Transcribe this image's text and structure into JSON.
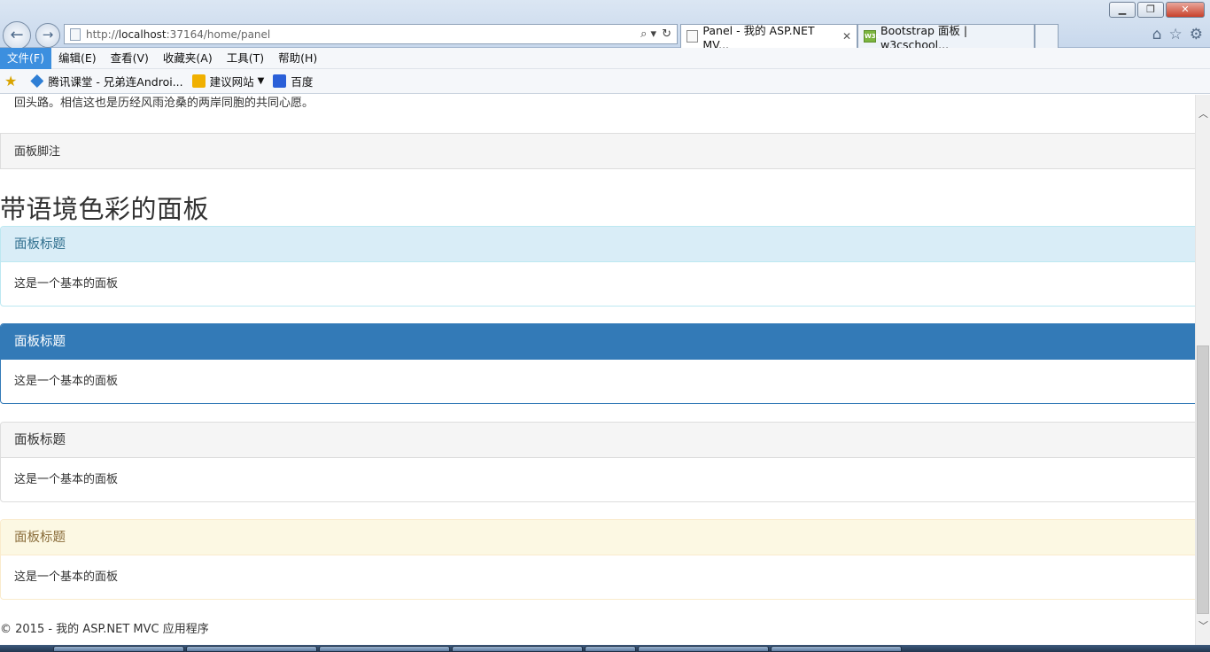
{
  "window": {
    "buttons": {
      "minimize": "▁",
      "restore": "❐",
      "close": "✕"
    }
  },
  "browser": {
    "address": {
      "prefix": "http://",
      "host": "localhost",
      "rest": ":37164/home/panel",
      "search_icon": "⌕ ▾",
      "refresh_icon": "↻"
    },
    "tabs": [
      {
        "title": "Panel - 我的 ASP.NET MV...",
        "close": "✕",
        "icon": "page-icon"
      },
      {
        "title": "Bootstrap 面板 | w3cschool...",
        "icon": "w3c-icon",
        "icon_text": "W3C"
      }
    ],
    "tools": {
      "home": "⌂",
      "favorites": "☆",
      "settings": "⚙"
    },
    "menu": [
      {
        "label": "文件(F)"
      },
      {
        "label": "编辑(E)"
      },
      {
        "label": "查看(V)"
      },
      {
        "label": "收藏夹(A)"
      },
      {
        "label": "工具(T)"
      },
      {
        "label": "帮助(H)"
      }
    ],
    "favorites": [
      {
        "label": "腾讯课堂 - 兄弟连Androi...",
        "icon": "tencent-icon"
      },
      {
        "label": "建议网站",
        "icon": "bing-icon",
        "caret": "▼"
      },
      {
        "label": "百度",
        "icon": "baidu-icon"
      }
    ]
  },
  "page": {
    "body_tail": "回头路。相信这也是历经风雨沧桑的两岸同胞的共同心愿。",
    "panel_footer": "面板脚注",
    "section_title": "带语境色彩的面板",
    "panels": [
      {
        "style": "info",
        "title": "面板标题",
        "body": "这是一个基本的面板",
        "header_color": "#d9edf7"
      },
      {
        "style": "primary",
        "title": "面板标题",
        "body": "这是一个基本的面板",
        "header_color": "#337ab7"
      },
      {
        "style": "default",
        "title": "面板标题",
        "body": "这是一个基本的面板",
        "header_color": "#f5f5f5"
      },
      {
        "style": "warning",
        "title": "面板标题",
        "body": "这是一个基本的面板",
        "header_color": "#fcf8e3"
      }
    ],
    "footer": "© 2015 - 我的 ASP.NET MVC 应用程序"
  },
  "scrollbar": {
    "up": "︿",
    "down": "﹀"
  }
}
